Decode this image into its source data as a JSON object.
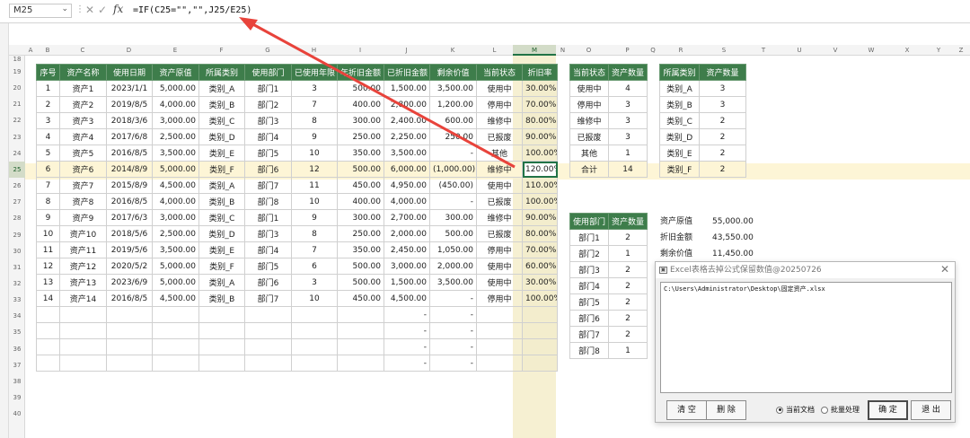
{
  "formula_bar": {
    "name_box": "M25",
    "fx": "fx",
    "formula": "=IF(C25=\"\",\"\",J25/E25)"
  },
  "columns": [
    "A",
    "B",
    "C",
    "D",
    "E",
    "F",
    "G",
    "H",
    "I",
    "J",
    "K",
    "L",
    "M",
    "N",
    "O",
    "P",
    "Q",
    "R",
    "S",
    "T",
    "U",
    "V",
    "W",
    "X",
    "Y",
    "Z"
  ],
  "rows": [
    "18",
    "19",
    "20",
    "21",
    "22",
    "23",
    "24",
    "25",
    "26",
    "27",
    "28",
    "29",
    "30",
    "31",
    "32",
    "33",
    "34",
    "35",
    "36",
    "37",
    "38",
    "39",
    "40"
  ],
  "main_table": {
    "headers": [
      "序号",
      "资产名称",
      "使用日期",
      "资产原值",
      "所属类别",
      "使用部门",
      "已使用年限",
      "年折旧金额",
      "已折旧金额",
      "剩余价值",
      "当前状态",
      "折旧率"
    ],
    "rows": [
      [
        "1",
        "资产1",
        "2023/1/1",
        "5,000.00",
        "类别_A",
        "部门1",
        "3",
        "500.00",
        "1,500.00",
        "3,500.00",
        "使用中",
        "30.00%"
      ],
      [
        "2",
        "资产2",
        "2019/8/5",
        "4,000.00",
        "类别_B",
        "部门2",
        "7",
        "400.00",
        "2,800.00",
        "1,200.00",
        "停用中",
        "70.00%"
      ],
      [
        "3",
        "资产3",
        "2018/3/6",
        "3,000.00",
        "类别_C",
        "部门3",
        "8",
        "300.00",
        "2,400.00",
        "600.00",
        "维修中",
        "80.00%"
      ],
      [
        "4",
        "资产4",
        "2017/6/8",
        "2,500.00",
        "类别_D",
        "部门4",
        "9",
        "250.00",
        "2,250.00",
        "250.00",
        "已报废",
        "90.00%"
      ],
      [
        "5",
        "资产5",
        "2016/8/5",
        "3,500.00",
        "类别_E",
        "部门5",
        "10",
        "350.00",
        "3,500.00",
        "-",
        "其他",
        "100.00%"
      ],
      [
        "6",
        "资产6",
        "2014/8/9",
        "5,000.00",
        "类别_F",
        "部门6",
        "12",
        "500.00",
        "6,000.00",
        "(1,000.00)",
        "维修中",
        "120.00%"
      ],
      [
        "7",
        "资产7",
        "2015/8/9",
        "4,500.00",
        "类别_A",
        "部门7",
        "11",
        "450.00",
        "4,950.00",
        "(450.00)",
        "使用中",
        "110.00%"
      ],
      [
        "8",
        "资产8",
        "2016/8/5",
        "4,000.00",
        "类别_B",
        "部门8",
        "10",
        "400.00",
        "4,000.00",
        "-",
        "已报废",
        "100.00%"
      ],
      [
        "9",
        "资产9",
        "2017/6/3",
        "3,000.00",
        "类别_C",
        "部门1",
        "9",
        "300.00",
        "2,700.00",
        "300.00",
        "维修中",
        "90.00%"
      ],
      [
        "10",
        "资产10",
        "2018/5/6",
        "2,500.00",
        "类别_D",
        "部门3",
        "8",
        "250.00",
        "2,000.00",
        "500.00",
        "已报废",
        "80.00%"
      ],
      [
        "11",
        "资产11",
        "2019/5/6",
        "3,500.00",
        "类别_E",
        "部门4",
        "7",
        "350.00",
        "2,450.00",
        "1,050.00",
        "停用中",
        "70.00%"
      ],
      [
        "12",
        "资产12",
        "2020/5/2",
        "5,000.00",
        "类别_F",
        "部门5",
        "6",
        "500.00",
        "3,000.00",
        "2,000.00",
        "使用中",
        "60.00%"
      ],
      [
        "13",
        "资产13",
        "2023/6/9",
        "5,000.00",
        "类别_A",
        "部门6",
        "3",
        "500.00",
        "1,500.00",
        "3,500.00",
        "使用中",
        "30.00%"
      ],
      [
        "14",
        "资产14",
        "2016/8/5",
        "4,500.00",
        "类别_B",
        "部门7",
        "10",
        "450.00",
        "4,500.00",
        "-",
        "停用中",
        "100.00%"
      ],
      [
        "",
        "",
        "",
        "",
        "",
        "",
        "",
        "",
        "-",
        "-",
        "",
        ""
      ],
      [
        "",
        "",
        "",
        "",
        "",
        "",
        "",
        "",
        "-",
        "-",
        "",
        ""
      ],
      [
        "",
        "",
        "",
        "",
        "",
        "",
        "",
        "",
        "-",
        "-",
        "",
        ""
      ],
      [
        "",
        "",
        "",
        "",
        "",
        "",
        "",
        "",
        "-",
        "-",
        "",
        ""
      ]
    ]
  },
  "status_table": {
    "headers": [
      "当前状态",
      "资产数量"
    ],
    "rows": [
      [
        "使用中",
        "4"
      ],
      [
        "停用中",
        "3"
      ],
      [
        "维修中",
        "3"
      ],
      [
        "已报废",
        "3"
      ],
      [
        "其他",
        "1"
      ],
      [
        "合计",
        "14"
      ]
    ]
  },
  "category_table": {
    "headers": [
      "所属类别",
      "资产数量"
    ],
    "rows": [
      [
        "类别_A",
        "3"
      ],
      [
        "类别_B",
        "3"
      ],
      [
        "类别_C",
        "2"
      ],
      [
        "类别_D",
        "2"
      ],
      [
        "类别_E",
        "2"
      ],
      [
        "类别_F",
        "2"
      ]
    ]
  },
  "dept_table": {
    "headers": [
      "使用部门",
      "资产数量"
    ],
    "rows": [
      [
        "部门1",
        "2"
      ],
      [
        "部门2",
        "1"
      ],
      [
        "部门3",
        "2"
      ],
      [
        "部门4",
        "2"
      ],
      [
        "部门5",
        "2"
      ],
      [
        "部门6",
        "2"
      ],
      [
        "部门7",
        "2"
      ],
      [
        "部门8",
        "1"
      ]
    ]
  },
  "summary": [
    {
      "label": "资产原值",
      "value": "55,000.00"
    },
    {
      "label": "折旧金额",
      "value": "43,550.00"
    },
    {
      "label": "剩余价值",
      "value": "11,450.00"
    }
  ],
  "dialog": {
    "title": "Excel表格去掉公式保留数值@20250726",
    "path_text": "C:\\Users\\Administrator\\Desktop\\固定资产.xlsx",
    "clear_label": "清 空",
    "delete_label": "删 除",
    "radio_current": "当前文档",
    "radio_batch": "批量处理",
    "ok_label": "确 定",
    "exit_label": "退 出"
  },
  "colors": {
    "header_green": "#3e7d4b",
    "selection_green": "#217346",
    "arrow_red": "#e8433b",
    "highlight_row": "#fdf5d6"
  }
}
